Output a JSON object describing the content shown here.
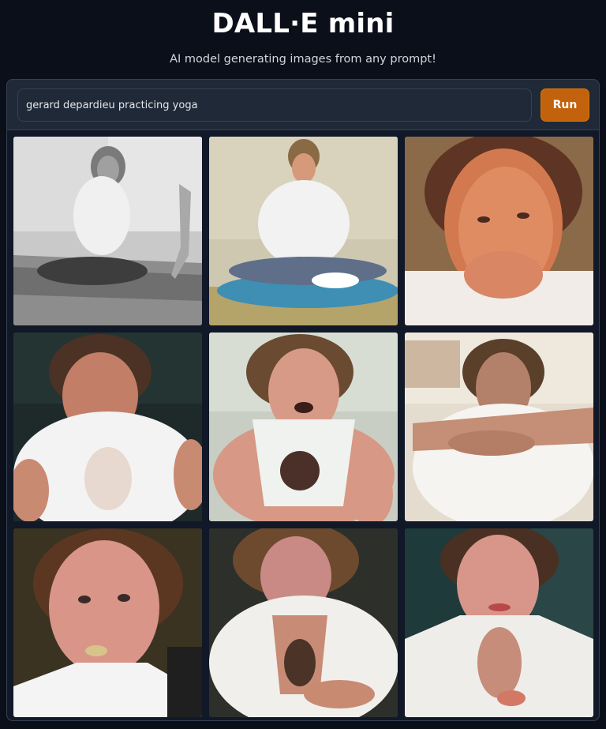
{
  "header": {
    "title": "DALL·E mini",
    "subtitle": "AI model generating images from any prompt!"
  },
  "prompt": {
    "value": "gerard depardieu practicing yoga",
    "run_label": "Run"
  },
  "gallery": {
    "images": [
      {
        "name": "generated-image-1",
        "scene": "grayscale yoga pose on mat, kneeling"
      },
      {
        "name": "generated-image-2",
        "scene": "man in white shirt sitting cross-legged on blue mat"
      },
      {
        "name": "generated-image-3",
        "scene": "close-up face portrait, warm tones"
      },
      {
        "name": "generated-image-4",
        "scene": "man in white shirt leaning, dark background"
      },
      {
        "name": "generated-image-5",
        "scene": "man in white tank top lying, mouth open"
      },
      {
        "name": "generated-image-6",
        "scene": "man with arms crossed over knees, white shirt"
      },
      {
        "name": "generated-image-7",
        "scene": "close-up face with dark hair, white collar"
      },
      {
        "name": "generated-image-8",
        "scene": "man in open white shirt, arms folded"
      },
      {
        "name": "generated-image-9",
        "scene": "close-up face, open white shirt, dark background"
      }
    ]
  }
}
